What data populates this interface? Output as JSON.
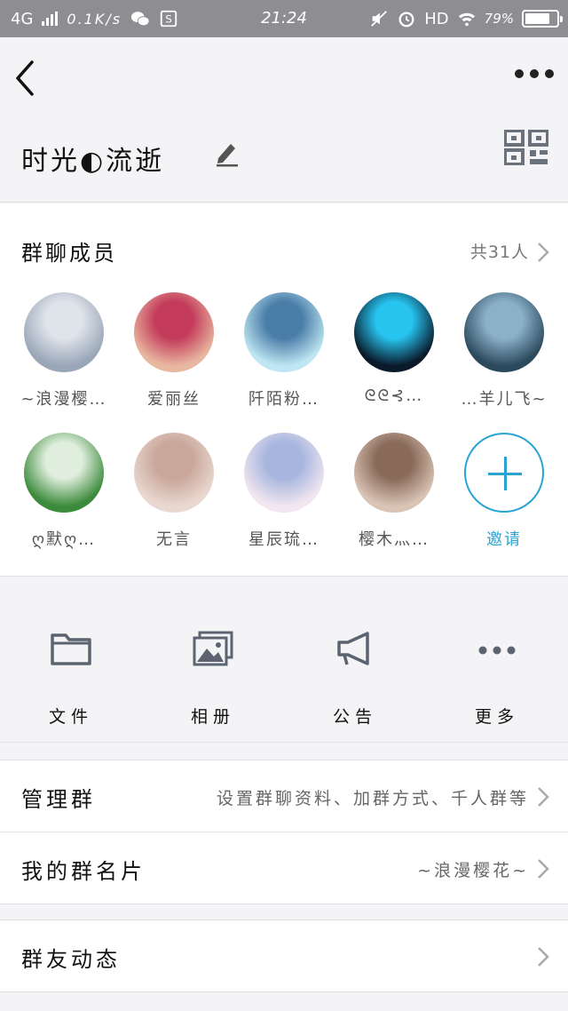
{
  "status_bar": {
    "network": "4G",
    "speed": "0.1K/s",
    "time": "21:24",
    "hd": "HD",
    "battery": "79%",
    "battery_level": 0.79
  },
  "header": {
    "group_name": "时光◐流逝"
  },
  "members": {
    "title": "群聊成员",
    "count": "共31人",
    "list": [
      {
        "name": "~浪漫樱…",
        "colors": [
          "#9aa7b8",
          "#dfe3ea"
        ]
      },
      {
        "name": "爱丽丝",
        "colors": [
          "#e8b7a0",
          "#c33a5a"
        ]
      },
      {
        "name": "阡陌粉…",
        "colors": [
          "#bfe6f2",
          "#4a7da8"
        ]
      },
      {
        "name": "ᘓᘓ⊰…",
        "colors": [
          "#0a1a2a",
          "#27c4f0"
        ]
      },
      {
        "name": "…羊儿飞~",
        "colors": [
          "#2c4a5e",
          "#8bb1c9"
        ]
      },
      {
        "name": "ღ默ღ…",
        "colors": [
          "#3c8a3c",
          "#dfeedd"
        ]
      },
      {
        "name": "无言",
        "colors": [
          "#e9d8d0",
          "#c9a79a"
        ]
      },
      {
        "name": "星辰琉…",
        "colors": [
          "#f2e6f0",
          "#a7b6de"
        ]
      },
      {
        "name": "樱木灬…",
        "colors": [
          "#d9c3b5",
          "#8a6b5a"
        ]
      }
    ],
    "invite_label": "邀请"
  },
  "actions": [
    {
      "label": "文件",
      "icon": "folder-icon"
    },
    {
      "label": "相册",
      "icon": "album-icon"
    },
    {
      "label": "公告",
      "icon": "megaphone-icon"
    },
    {
      "label": "更多",
      "icon": "more-dots-icon"
    }
  ],
  "rows": {
    "manage": {
      "label": "管理群",
      "value": "设置群聊资料、加群方式、千人群等"
    },
    "card": {
      "label": "我的群名片",
      "value": "~浪漫樱花~"
    },
    "feed": {
      "label": "群友动态",
      "value": ""
    }
  },
  "colors": {
    "accent": "#2aa3d3",
    "status_bar": "#8e8e92",
    "icon_gray": "#5b6470"
  }
}
